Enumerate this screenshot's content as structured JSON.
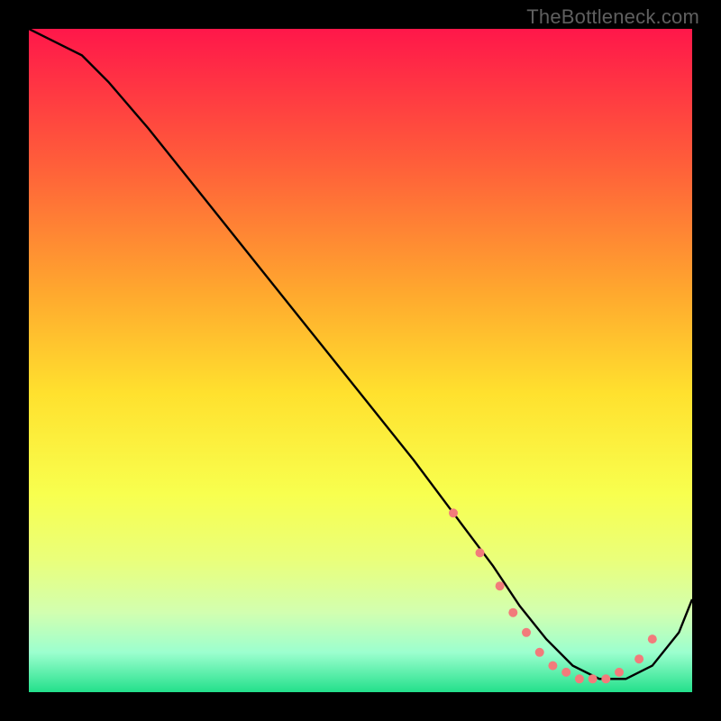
{
  "watermark": "TheBottleneck.com",
  "colors": {
    "bg": "#000000",
    "curve": "#000000",
    "marker": "#f27b7b",
    "watermark": "#5f5f5f"
  },
  "chart_data": {
    "type": "line",
    "title": "",
    "xlabel": "",
    "ylabel": "",
    "xlim": [
      0,
      100
    ],
    "ylim": [
      0,
      100
    ],
    "gradient_stops": [
      {
        "offset": 0.0,
        "color": "#ff174a"
      },
      {
        "offset": 0.2,
        "color": "#ff5d3a"
      },
      {
        "offset": 0.4,
        "color": "#ffa92e"
      },
      {
        "offset": 0.55,
        "color": "#ffe12e"
      },
      {
        "offset": 0.7,
        "color": "#f8ff4e"
      },
      {
        "offset": 0.8,
        "color": "#eaff7a"
      },
      {
        "offset": 0.88,
        "color": "#d2ffb0"
      },
      {
        "offset": 0.94,
        "color": "#9cffcf"
      },
      {
        "offset": 1.0,
        "color": "#23e08b"
      }
    ],
    "series": [
      {
        "name": "bottleneck-curve",
        "x": [
          0,
          4,
          8,
          12,
          18,
          26,
          34,
          42,
          50,
          58,
          64,
          70,
          74,
          78,
          82,
          86,
          90,
          94,
          98,
          100
        ],
        "y": [
          100,
          98,
          96,
          92,
          85,
          75,
          65,
          55,
          45,
          35,
          27,
          19,
          13,
          8,
          4,
          2,
          2,
          4,
          9,
          14
        ]
      }
    ],
    "markers": {
      "name": "highlight-dots",
      "x": [
        64,
        68,
        71,
        73,
        75,
        77,
        79,
        81,
        83,
        85,
        87,
        89,
        92,
        94
      ],
      "y": [
        27,
        21,
        16,
        12,
        9,
        6,
        4,
        3,
        2,
        2,
        2,
        3,
        5,
        8
      ],
      "r": 5
    }
  }
}
